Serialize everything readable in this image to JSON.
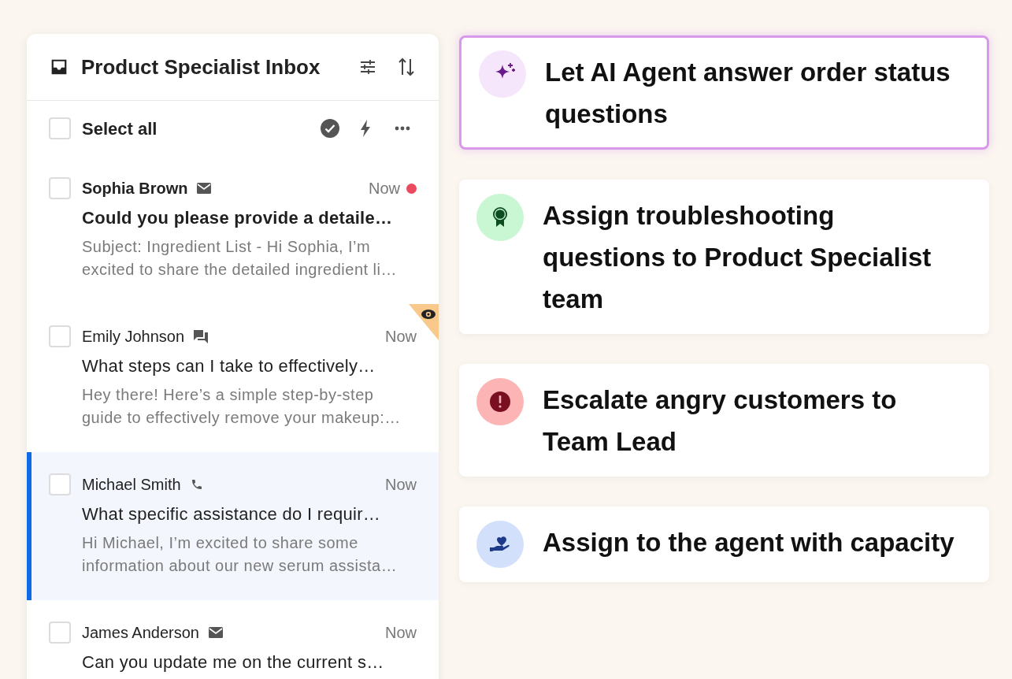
{
  "inbox": {
    "title": "Product Specialist Inbox",
    "select_all": {
      "label": "Select all",
      "checked": false
    },
    "conversations": [
      {
        "sender": "Sophia Brown",
        "kind": "email",
        "time": "Now",
        "unread": true,
        "viewing": false,
        "selected": false,
        "checked": false,
        "subject": "Could you please provide a detaile…",
        "preview": "Subject: Ingredient List - Hi Sophia, I’m excited to share the detailed ingredient li…"
      },
      {
        "sender": "Emily Johnson",
        "kind": "chat",
        "time": "Now",
        "unread": false,
        "viewing": true,
        "selected": false,
        "checked": false,
        "subject": "What steps can I take to effectively…",
        "preview": "Hey there! Here’s a simple step-by-step guide to effectively remove your makeup:…"
      },
      {
        "sender": "Michael Smith",
        "kind": "phone",
        "time": "Now",
        "unread": false,
        "viewing": false,
        "selected": true,
        "checked": false,
        "subject": "What specific assistance do I requir…",
        "preview": "Hi Michael, I’m excited to share some information about our new serum assista…"
      },
      {
        "sender": "James Anderson",
        "kind": "email",
        "time": "Now",
        "unread": false,
        "viewing": false,
        "selected": false,
        "checked": false,
        "subject": "Can you update me on the current s…"
      }
    ]
  },
  "rules": [
    {
      "text": "Let AI Agent answer order status questions",
      "kind": "sparkle",
      "highlighted": true
    },
    {
      "text": "Assign troubleshooting questions to Product Specialist team",
      "kind": "ribbon",
      "highlighted": false
    },
    {
      "text": "Escalate angry customers to Team Lead",
      "kind": "alert",
      "highlighted": false
    },
    {
      "text": "Assign to the agent with capacity",
      "kind": "hand-heart",
      "highlighted": false
    }
  ]
}
